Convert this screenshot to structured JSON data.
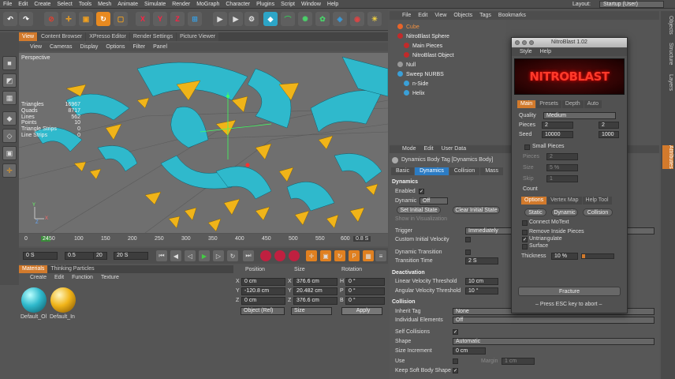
{
  "menubar": {
    "items": [
      "File",
      "Edit",
      "Create",
      "Select",
      "Tools",
      "Mesh",
      "Animate",
      "Simulate",
      "Render",
      "MoGraph",
      "Character",
      "Plugins",
      "Script",
      "Window",
      "Help"
    ],
    "layout_label": "Layout:",
    "layout_value": "Startup (User)"
  },
  "toolbar": {
    "axis_x": "X",
    "axis_y": "Y",
    "axis_z": "Z"
  },
  "view_tabs": [
    "View",
    "Content Browser",
    "XPresso Editor",
    "Render Settings",
    "Picture Viewer"
  ],
  "view_menu": [
    "View",
    "Cameras",
    "Display",
    "Options",
    "Filter",
    "Panel"
  ],
  "viewport": {
    "title": "Perspective",
    "stats": [
      {
        "label": "Triangles",
        "value": "16967"
      },
      {
        "label": "Quads",
        "value": "8717"
      },
      {
        "label": "Lines",
        "value": "562"
      },
      {
        "label": "Points",
        "value": "10"
      },
      {
        "label": "Triangle Strips",
        "value": "0"
      },
      {
        "label": "Line Strips",
        "value": "0"
      }
    ],
    "axis_y": "Y",
    "axis_x": "X",
    "axis_z": "Z",
    "colors": {
      "bg": "#6f6f6f",
      "cyan": "#2fb9cc",
      "yellow": "#f0b419"
    }
  },
  "timeline": {
    "ticks": [
      "0",
      "24",
      "50",
      "100",
      "150",
      "200",
      "250",
      "300",
      "350",
      "400",
      "450",
      "500",
      "550",
      "600"
    ],
    "current_frame": "24",
    "frame_readout": "0.8 S",
    "playhead_fraction": 0.04
  },
  "transport": {
    "start": "0 S",
    "current": "0.5",
    "range": "20",
    "end": "20 S"
  },
  "materials": {
    "tabs": [
      "Materials",
      "Thinking Particles"
    ],
    "menu": [
      "Create",
      "Edit",
      "Function",
      "Texture"
    ],
    "items": [
      {
        "name": "Default_Ol",
        "color": "#2fb9cc"
      },
      {
        "name": "Default_In",
        "color": "#f0b419"
      }
    ]
  },
  "coords": {
    "headers": [
      "Position",
      "Size",
      "Rotation"
    ],
    "rows": [
      {
        "axis": "X",
        "pos": "0 cm",
        "size_axis": "X",
        "size": "376.6 cm",
        "rot_axis": "H",
        "rot": "0 °"
      },
      {
        "axis": "Y",
        "pos": "-120.8 cm",
        "size_axis": "Y",
        "size": "20.482 cm",
        "rot_axis": "P",
        "rot": "0 °"
      },
      {
        "axis": "Z",
        "pos": "0 cm",
        "size_axis": "Z",
        "size": "376.6 cm",
        "rot_axis": "B",
        "rot": "0 °"
      }
    ],
    "mode": "Object (Rel)",
    "size_mode": "Size",
    "apply": "Apply"
  },
  "objects": {
    "menu": [
      "File",
      "Edit",
      "View",
      "Objects",
      "Tags",
      "Bookmarks"
    ],
    "items": [
      {
        "name": "Cube",
        "color": "#e8642a",
        "indent": 0,
        "highlight": true
      },
      {
        "name": "NitroBlast Sphere",
        "color": "#c22a2a",
        "indent": 0,
        "highlight": false
      },
      {
        "name": "Main Pieces",
        "color": "#c22a2a",
        "indent": 1,
        "highlight": false
      },
      {
        "name": "NitroBlast Object",
        "color": "#c22a2a",
        "indent": 1,
        "highlight": false
      },
      {
        "name": "Null",
        "color": "#999999",
        "indent": 0,
        "highlight": false
      },
      {
        "name": "Sweep NURBS",
        "color": "#3aa0d8",
        "indent": 0,
        "highlight": false
      },
      {
        "name": "n-Side",
        "color": "#3aa0d8",
        "indent": 1,
        "highlight": false
      },
      {
        "name": "Helix",
        "color": "#3aa0d8",
        "indent": 1,
        "highlight": false
      }
    ]
  },
  "attributes": {
    "menu": [
      "Mode",
      "Edit",
      "User Data"
    ],
    "header": "Dynamics Body Tag [Dynamics Body]",
    "tabs": [
      "Basic",
      "Dynamics",
      "Collision",
      "Mass"
    ],
    "active_tab": "Dynamics",
    "section_dynamics": "Dynamics",
    "enabled": "Enabled",
    "dynamic_label": "Dynamic",
    "dynamic_value": "Off",
    "set_initial": "Set Initial State",
    "clear_initial": "Clear Initial State",
    "show_vis": "Show in Visualization",
    "trigger_label": "Trigger",
    "trigger_value": "Immediately",
    "custom_vel": "Custom Initial Velocity",
    "dyn_transition": "Dynamic Transition",
    "transition_time": "Transition Time",
    "transition_time_value": "2 S",
    "section_deactivation": "Deactivation",
    "lin_vel": "Linear Velocity Threshold",
    "lin_vel_value": "10 cm",
    "ang_vel": "Angular Velocity Threshold",
    "ang_vel_value": "10 °",
    "section_collision": "Collision",
    "inherit_tag": "Inherit Tag",
    "inherit_tag_value": "None",
    "indiv_elements": "Individual Elements",
    "indiv_elements_value": "Off",
    "self_collisions": "Self Collisions",
    "shape": "Shape",
    "shape_value": "Automatic",
    "size_increment": "Size Increment",
    "size_increment_value": "0 cm",
    "use": "Use",
    "margin": "Margin",
    "margin_value": "1 cm",
    "keep_soft": "Keep Soft Body Shape"
  },
  "right_tabs": [
    "Objects",
    "Structure",
    "Layers",
    "Attributes"
  ],
  "nitroblast": {
    "title": "NitroBlast 1.02",
    "menu": [
      "Style",
      "Help"
    ],
    "banner": "NITROBLAST",
    "tabs": [
      "Main",
      "Presets",
      "Depth",
      "Auto"
    ],
    "quality_label": "Quality",
    "quality_value": "Medium",
    "pieces_label": "Pieces",
    "pieces_a": "2",
    "pieces_b": "2",
    "seed_label": "Seed",
    "seed_a": "10000",
    "seed_b": "1000",
    "small_pieces": "Small Pieces",
    "sp_pieces": "Pieces",
    "sp_pieces_val": "2",
    "sp_size": "Size",
    "sp_size_val": "5 %",
    "sp_skip": "Skip",
    "sp_skip_val": "1",
    "count": "Count",
    "opt_tabs": [
      "Options",
      "Vertex Map",
      "Help Tool"
    ],
    "static": "Static",
    "dynamic": "Dynamic",
    "collision": "Collision",
    "connect_mo": "Connect MoText",
    "remove_inside": "Remove Inside Pieces",
    "untriangulate": "Untriangulate",
    "surface": "Surface",
    "thickness_label": "Thickness",
    "thickness_value": "10 %",
    "fracture": "Fracture",
    "press_esc": "– Press ESC key to abort –"
  }
}
